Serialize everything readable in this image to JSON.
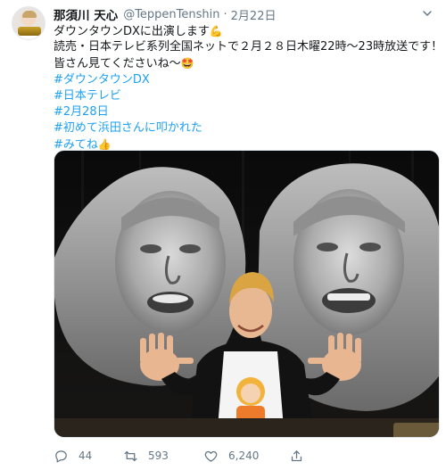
{
  "tweet": {
    "author_name": "那須川 天心",
    "handle": "@TeppenTenshin",
    "separator": "·",
    "date": "2月22日",
    "lines": [
      {
        "text": "ダウンタウンDXに出演します",
        "emoji": "💪",
        "hashtag": false
      },
      {
        "text": "読売・日本テレビ系列全国ネットで２月２８日木曜22時〜23時放送です！",
        "emoji": "",
        "hashtag": false
      },
      {
        "text": "皆さん見てくださいね〜",
        "emoji": "🤩",
        "hashtag": false
      },
      {
        "text": "#ダウンタウンDX",
        "emoji": "",
        "hashtag": true
      },
      {
        "text": "#日本テレビ",
        "emoji": "",
        "hashtag": true
      },
      {
        "text": "#2月28日",
        "emoji": "",
        "hashtag": true
      },
      {
        "text": "#初めて浜田さんに叩かれた",
        "emoji": "",
        "hashtag": true
      },
      {
        "text": "#みてね",
        "emoji": "👍",
        "hashtag": true
      }
    ]
  },
  "actions": {
    "reply_count": "44",
    "retweet_count": "593",
    "like_count": "6,240",
    "reply_icon": "reply-icon",
    "retweet_icon": "retweet-icon",
    "like_icon": "heart-icon",
    "share_icon": "share-icon"
  },
  "colors": {
    "link": "#1da1f2",
    "muted": "#657786",
    "text": "#14171a"
  }
}
